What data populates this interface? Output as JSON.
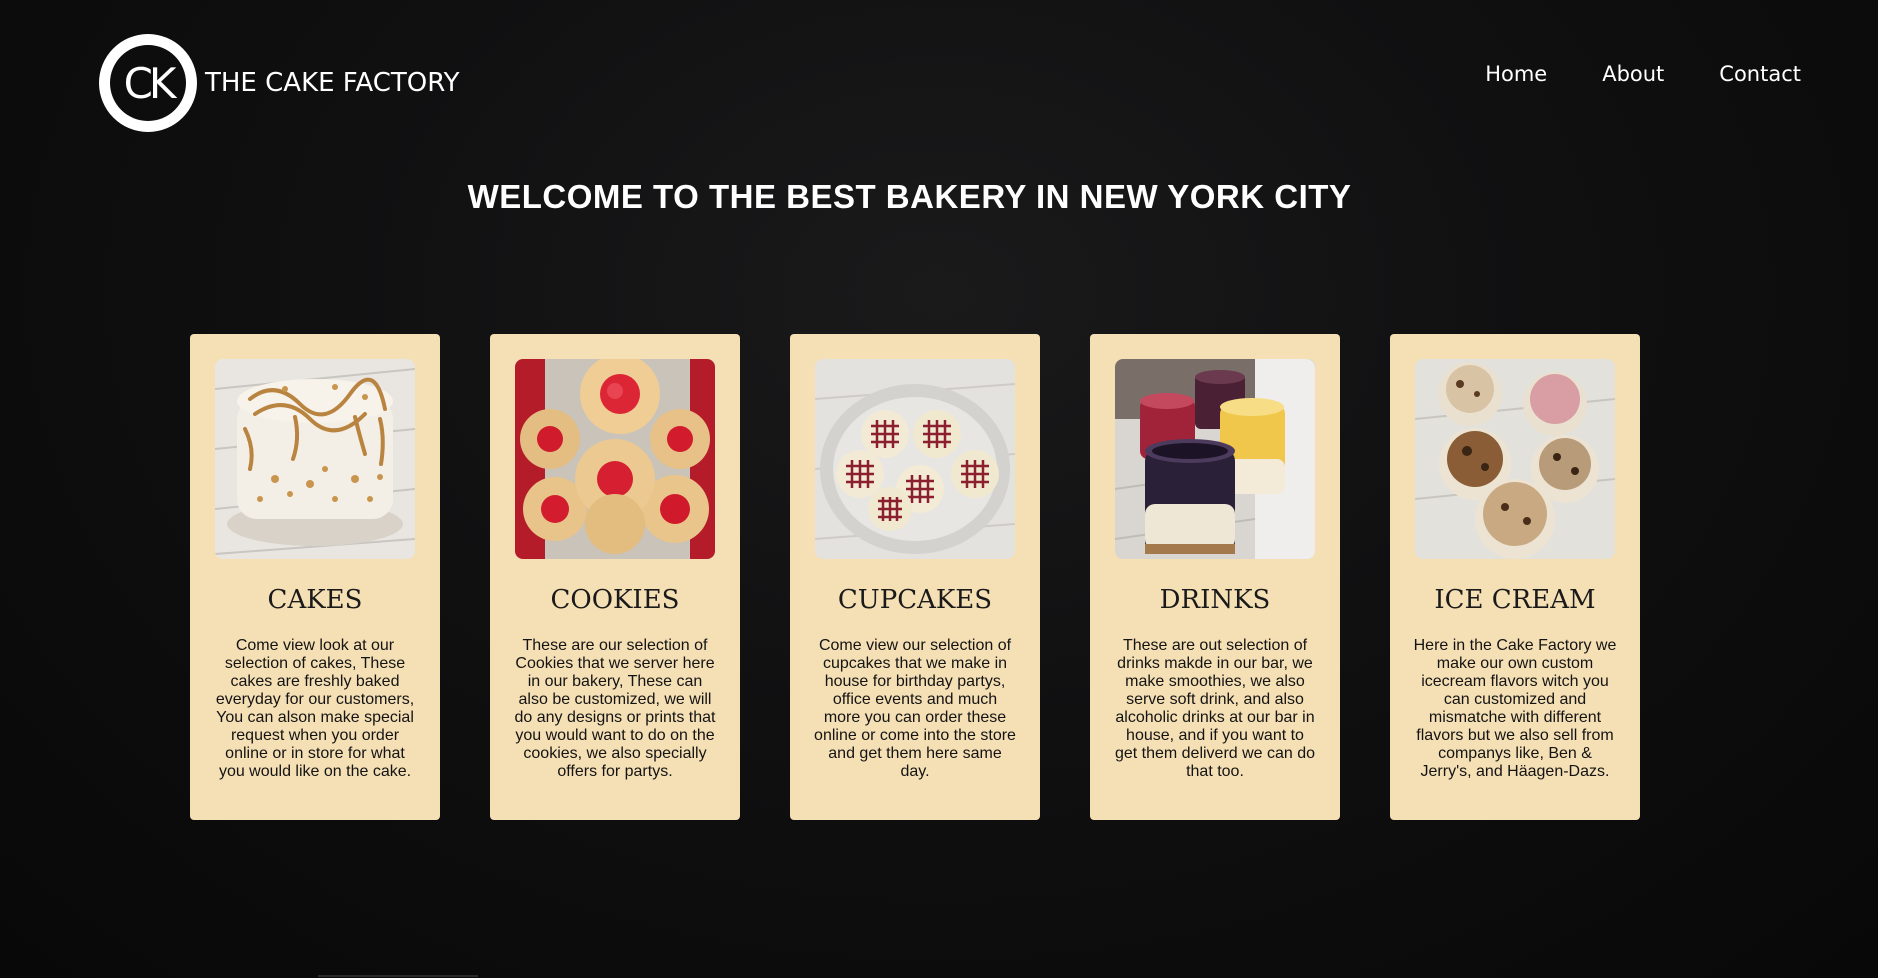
{
  "header": {
    "logo_initials": "CK",
    "logo_text": "THE CAKE FACTORY",
    "nav": [
      {
        "label": "Home"
      },
      {
        "label": "About"
      },
      {
        "label": "Contact"
      }
    ]
  },
  "main": {
    "headline": "WELCOME TO THE BEST BAKERY IN NEW YORK CITY",
    "cards": [
      {
        "title": "CAKES",
        "image": "cake-photo",
        "description": "Come view look at our selection of cakes, These cakes are freshly baked everyday for our customers, You can alson make special request when you order online or in store for what you would like on the cake."
      },
      {
        "title": "COOKIES",
        "image": "cookies-photo",
        "description": "These are our selection of Cookies that we server here in our bakery, These can also be customized, we will do any designs or prints that you would want to do on the cookies, we also specially offers for partys."
      },
      {
        "title": "CUPCAKES",
        "image": "cupcakes-photo",
        "description": "Come view our selection of cupcakes that we make in house for birthday partys, office events and much more you can order these online or come into the store and get them here same day."
      },
      {
        "title": "DRINKS",
        "image": "drinks-photo",
        "description": "These are out selection of drinks makde in our bar, we make smoothies, we also serve soft drink, and also alcoholic drinks at our bar in house, and if you want to get them deliverd we can do that too."
      },
      {
        "title": "ICE CREAM",
        "image": "ice-cream-photo",
        "description": "Here in the Cake Factory we make our own custom icecream flavors witch you can customized and mismatche with different flavors but we also sell from companys like, Ben & Jerry's, and Häagen-Dazs."
      }
    ]
  },
  "colors": {
    "background": "#0f0f10",
    "card_background": "#f5dfb4",
    "text_light": "#ffffff",
    "text_dark": "#141414"
  }
}
